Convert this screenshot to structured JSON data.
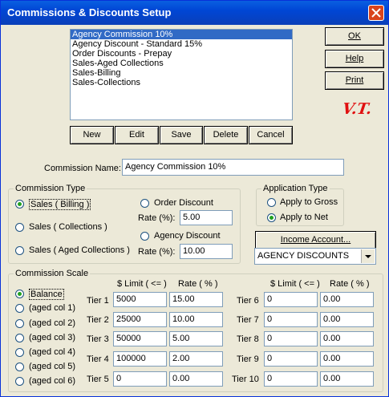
{
  "window": {
    "title": "Commissions & Discounts Setup"
  },
  "list": {
    "items": [
      "Agency Commission 10%",
      "Agency Discount - Standard 15%",
      "Order Discounts - Prepay",
      "Sales-Aged Collections",
      "Sales-Billing",
      "Sales-Collections"
    ],
    "selected": 0
  },
  "buttons": {
    "ok": "OK",
    "help": "Help",
    "print": "Print",
    "new": "New",
    "edit": "Edit",
    "save": "Save",
    "delete": "Delete",
    "cancel": "Cancel",
    "income_account": "Income Account..."
  },
  "mark": "V.T.",
  "commission_name": {
    "label": "Commission Name:",
    "value": "Agency Commission 10%"
  },
  "commission_type": {
    "label": "Commission Type",
    "sales_billing": "Sales ( Billing )",
    "sales_collections": "Sales ( Collections )",
    "sales_aged": "Sales ( Aged Collections )",
    "order_discount": "Order Discount",
    "agency_discount": "Agency Discount",
    "rate_label": "Rate (%):",
    "order_rate": "5.00",
    "agency_rate": "10.00"
  },
  "application_type": {
    "label": "Application Type",
    "gross": "Apply to Gross",
    "net": "Apply to Net"
  },
  "income_account_value": "AGENCY DISCOUNTS",
  "scale": {
    "label": "Commission Scale",
    "options": [
      "Balance",
      "(aged col 1)",
      "(aged col 2)",
      "(aged col 3)",
      "(aged col 4)",
      "(aged col 5)",
      "(aged col 6)"
    ],
    "limit_header": "$ Limit ( <= )",
    "rate_header": "Rate ( % )",
    "left_tiers": [
      {
        "name": "Tier 1",
        "limit": "5000",
        "rate": "15.00"
      },
      {
        "name": "Tier 2",
        "limit": "25000",
        "rate": "10.00"
      },
      {
        "name": "Tier 3",
        "limit": "50000",
        "rate": "5.00"
      },
      {
        "name": "Tier 4",
        "limit": "100000",
        "rate": "2.00"
      },
      {
        "name": "Tier 5",
        "limit": "0",
        "rate": "0.00"
      }
    ],
    "right_tiers": [
      {
        "name": "Tier 6",
        "limit": "0",
        "rate": "0.00"
      },
      {
        "name": "Tier 7",
        "limit": "0",
        "rate": "0.00"
      },
      {
        "name": "Tier 8",
        "limit": "0",
        "rate": "0.00"
      },
      {
        "name": "Tier 9",
        "limit": "0",
        "rate": "0.00"
      },
      {
        "name": "Tier 10",
        "limit": "0",
        "rate": "0.00"
      }
    ]
  }
}
